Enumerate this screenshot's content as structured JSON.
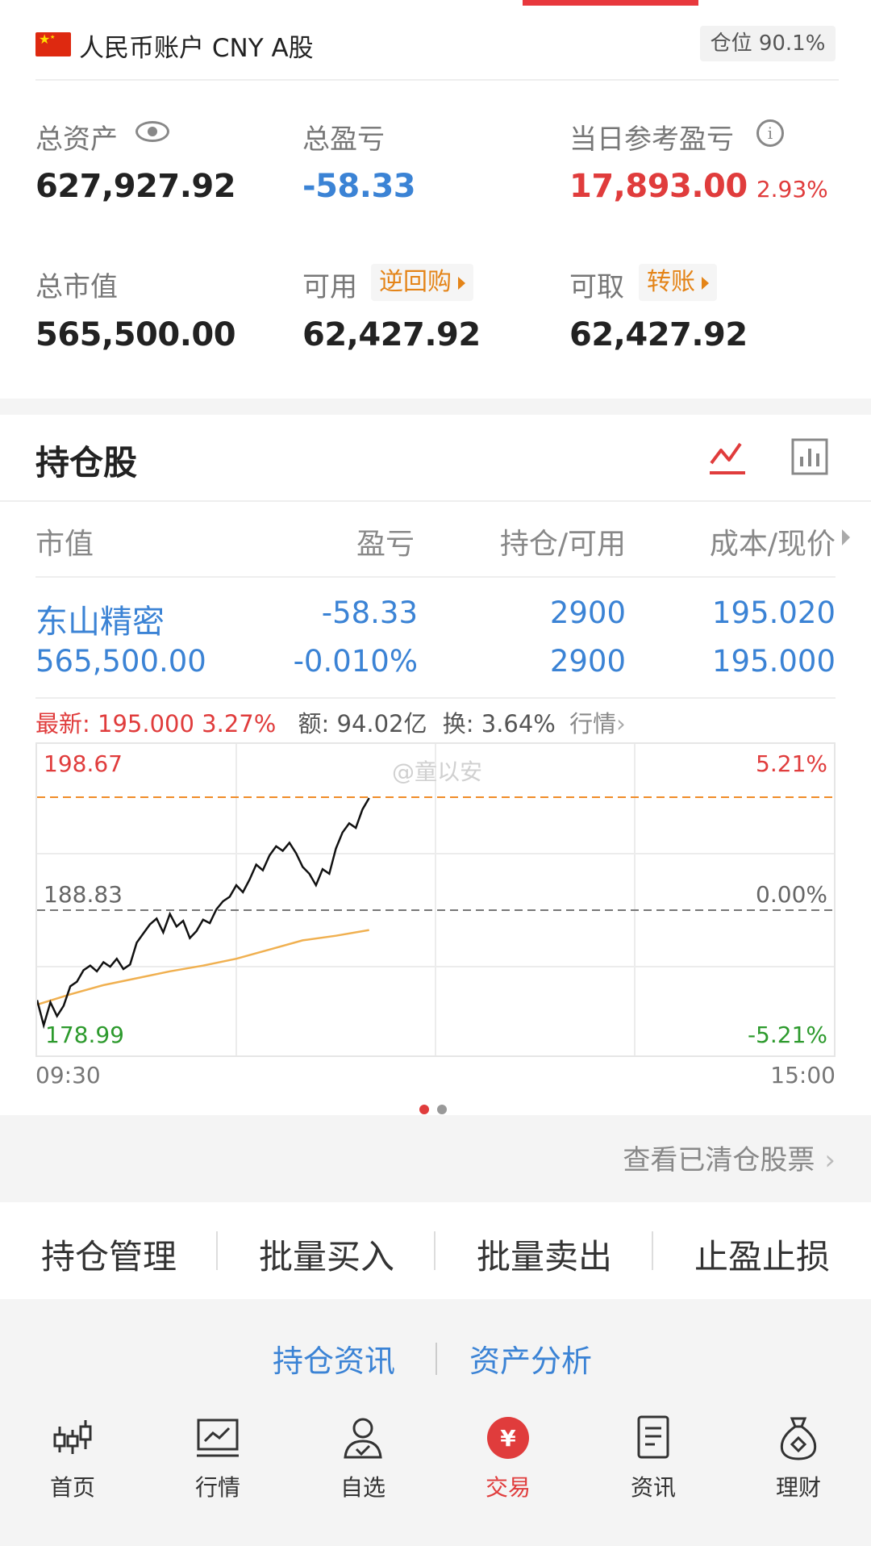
{
  "account": {
    "name": "人民币账户 CNY A股",
    "position_label": "仓位 90.1%"
  },
  "assets": {
    "total_assets_label": "总资产",
    "total_assets": "627,927.92",
    "total_pnl_label": "总盈亏",
    "total_pnl": "-58.33",
    "daily_pnl_label": "当日参考盈亏",
    "daily_pnl": "17,893.00",
    "daily_pnl_pct": "2.93%",
    "market_value_label": "总市值",
    "market_value": "565,500.00",
    "available_label": "可用",
    "repo_button": "逆回购",
    "available": "62,427.92",
    "withdrawable_label": "可取",
    "transfer_button": "转账",
    "withdrawable": "62,427.92"
  },
  "holdings": {
    "title": "持仓股",
    "columns": [
      "市值",
      "盈亏",
      "持仓/可用",
      "成本/现价"
    ],
    "rows": [
      {
        "name": "东山精密",
        "market_value": "565,500.00",
        "pnl": "-58.33",
        "pnl_pct": "-0.010%",
        "position": "2900",
        "available": "2900",
        "cost": "195.020",
        "price": "195.000"
      }
    ]
  },
  "quote": {
    "latest_label": "最新:",
    "latest_price": "195.000",
    "latest_pct": "3.27%",
    "amount": "额: 94.02亿",
    "turnover": "换: 3.64%",
    "market_link": "行情"
  },
  "chart_data": {
    "type": "line",
    "y_max_label": "198.67",
    "y_mid_label": "188.83",
    "y_min_label": "178.99",
    "pct_max_label": "5.21%",
    "pct_mid_label": "0.00%",
    "pct_min_label": "-5.21%",
    "x_start": "09:30",
    "x_end": "15:00",
    "ylim": [
      178.99,
      198.67
    ],
    "reference": 188.83,
    "dashed_high": 198.67,
    "watermark": "@童以安",
    "total_minutes": 240,
    "price_series": [
      [
        0,
        181.0
      ],
      [
        2,
        178.8
      ],
      [
        4,
        180.8
      ],
      [
        6,
        179.6
      ],
      [
        8,
        180.5
      ],
      [
        10,
        182.2
      ],
      [
        12,
        182.6
      ],
      [
        14,
        183.6
      ],
      [
        16,
        184.0
      ],
      [
        18,
        183.5
      ],
      [
        20,
        184.3
      ],
      [
        22,
        183.9
      ],
      [
        24,
        184.6
      ],
      [
        26,
        183.7
      ],
      [
        28,
        184.1
      ],
      [
        30,
        186.0
      ],
      [
        32,
        186.8
      ],
      [
        34,
        187.6
      ],
      [
        36,
        188.1
      ],
      [
        38,
        186.9
      ],
      [
        40,
        188.5
      ],
      [
        42,
        187.4
      ],
      [
        44,
        187.9
      ],
      [
        46,
        186.4
      ],
      [
        48,
        187.0
      ],
      [
        50,
        188.0
      ],
      [
        52,
        187.7
      ],
      [
        54,
        188.9
      ],
      [
        56,
        189.6
      ],
      [
        58,
        190.0
      ],
      [
        60,
        191.0
      ],
      [
        62,
        190.4
      ],
      [
        64,
        191.5
      ],
      [
        66,
        192.8
      ],
      [
        68,
        192.3
      ],
      [
        70,
        193.6
      ],
      [
        72,
        194.4
      ],
      [
        74,
        194.0
      ],
      [
        76,
        194.7
      ],
      [
        78,
        193.8
      ],
      [
        80,
        192.6
      ],
      [
        82,
        192.0
      ],
      [
        84,
        191.0
      ],
      [
        86,
        192.4
      ],
      [
        88,
        192.0
      ],
      [
        90,
        194.2
      ],
      [
        92,
        195.6
      ],
      [
        94,
        196.4
      ],
      [
        96,
        196.0
      ],
      [
        98,
        197.6
      ],
      [
        100,
        198.6
      ]
    ],
    "avg_series": [
      [
        0,
        180.6
      ],
      [
        10,
        181.5
      ],
      [
        20,
        182.3
      ],
      [
        30,
        182.9
      ],
      [
        40,
        183.5
      ],
      [
        50,
        184.0
      ],
      [
        60,
        184.6
      ],
      [
        70,
        185.4
      ],
      [
        80,
        186.2
      ],
      [
        90,
        186.6
      ],
      [
        100,
        187.1
      ]
    ],
    "colors": {
      "price": "#111111",
      "avg": "#f0b050",
      "up": "#e03c3c",
      "down": "#2d9a2d",
      "dashed_high": "#f08c28"
    }
  },
  "pager": {
    "pages": 2,
    "active": 0
  },
  "cleared_link": "查看已清仓股票",
  "actions": [
    "持仓管理",
    "批量买入",
    "批量卖出",
    "止盈止损"
  ],
  "links": [
    "持仓资讯",
    "资产分析"
  ],
  "nav": [
    {
      "label": "首页",
      "icon": "candlestick-icon"
    },
    {
      "label": "行情",
      "icon": "market-chart-icon"
    },
    {
      "label": "自选",
      "icon": "user-check-icon"
    },
    {
      "label": "交易",
      "icon": "yuan-icon",
      "active": true
    },
    {
      "label": "资讯",
      "icon": "document-icon"
    },
    {
      "label": "理财",
      "icon": "money-bag-icon"
    }
  ],
  "colors": {
    "red": "#e03c3c",
    "blue": "#3b83d5",
    "orange": "#e48418",
    "green": "#2d9a2d"
  }
}
